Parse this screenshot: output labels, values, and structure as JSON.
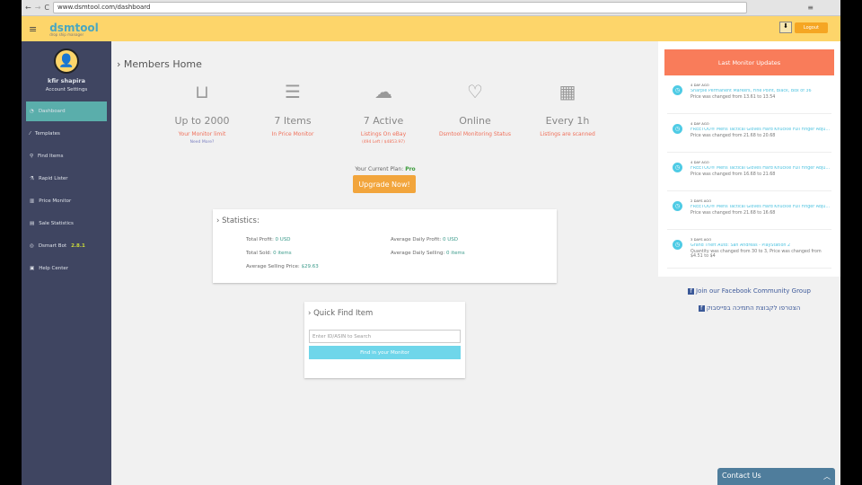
{
  "browser": {
    "url": "www.dsmtool.com/dashboard"
  },
  "header": {
    "logo": "dsmtool",
    "tagline": "drop ship manager",
    "logout": "Logout"
  },
  "user": {
    "name": "kfir shapira",
    "account_settings": "Account Settings"
  },
  "sidebar": {
    "items": [
      {
        "label": "Dashboard",
        "icon": "dashboard-icon"
      },
      {
        "label": "Templates",
        "icon": "brush-icon"
      },
      {
        "label": "Find Items",
        "icon": "search-icon"
      },
      {
        "label": "Rapid Lister",
        "icon": "flask-icon"
      },
      {
        "label": "Price Monitor",
        "icon": "bar-chart-icon"
      },
      {
        "label": "Sale Statistics",
        "icon": "table-icon"
      },
      {
        "label": "Dsmart Bot",
        "icon": "bot-icon",
        "badge": "2.8.1"
      },
      {
        "label": "Help Center",
        "icon": "help-icon"
      }
    ]
  },
  "main": {
    "title": "Members Home",
    "stats": [
      {
        "icon": "inbox-icon",
        "big": "Up to 2000",
        "label": "Your Monitor limit",
        "sub": "Need More?"
      },
      {
        "icon": "database-icon",
        "big": "7 Items",
        "label": "In Price Monitor"
      },
      {
        "icon": "cloud-icon",
        "big": "7 Active",
        "label": "Listings On eBay",
        "sub": "(494 Left / $4853.97)"
      },
      {
        "icon": "heart-icon",
        "big": "Online",
        "label": "Dsmtool Monitoring Status"
      },
      {
        "icon": "newspaper-icon",
        "big": "Every 1h",
        "label": "Listings are scanned"
      }
    ],
    "plan_label": "Your Current Plan:",
    "plan": "Pro",
    "upgrade": "Upgrade Now!",
    "statistics": {
      "title": "Statistics:",
      "total_profit_label": "Total Profit:",
      "total_profit": "0 USD",
      "avg_daily_profit_label": "Average Daily Profit:",
      "avg_daily_profit": "0 USD",
      "total_sold_label": "Total Sold:",
      "total_sold": "0 items",
      "avg_daily_selling_label": "Average Daily Selling:",
      "avg_daily_selling": "0 items",
      "avg_price_label": "Average Selling Price:",
      "avg_price": "$29.63"
    },
    "quick_find": {
      "title": "Quick Find Item",
      "placeholder": "Enter ID/ASIN to Search",
      "button": "Find in your Monitor"
    }
  },
  "updates": {
    "title": "Last Monitor Updates",
    "items": [
      {
        "time": "4 DAY AGO",
        "link": "Sharpie Permanent Markers, Fine Point, Black, Box of 36",
        "detail": "Price was changed from 13.61 to 13.54"
      },
      {
        "time": "4 DAY AGO",
        "link": "FREETOO® Mens Tactical Gloves Hard Knuckle Full Finger Adjustable",
        "detail": "Price was changed from 21.68 to 20.68"
      },
      {
        "time": "4 DAY AGO",
        "link": "FREETOO® Mens Tactical Gloves Hard Knuckle Full Finger Adjustable",
        "detail": "Price was changed from 16.68 to 21.68"
      },
      {
        "time": "2 DAYS AGO",
        "link": "FREETOO® Mens Tactical Gloves Hard Knuckle Full Finger Adjustable",
        "detail": "Price was changed from 21.68 to 16.68"
      },
      {
        "time": "3 DAYS AGO",
        "link": "Grand Theft Auto: San Andreas - PlayStation 2",
        "detail": "Quantity was changed from 30 to 3, Price was changed from $4.51 to $4"
      }
    ]
  },
  "facebook": {
    "en": "Join our Facebook Community Group",
    "he": "הצטרפו לקבוצת התמיכה בפייסבוק"
  },
  "contact": "Contact Us"
}
